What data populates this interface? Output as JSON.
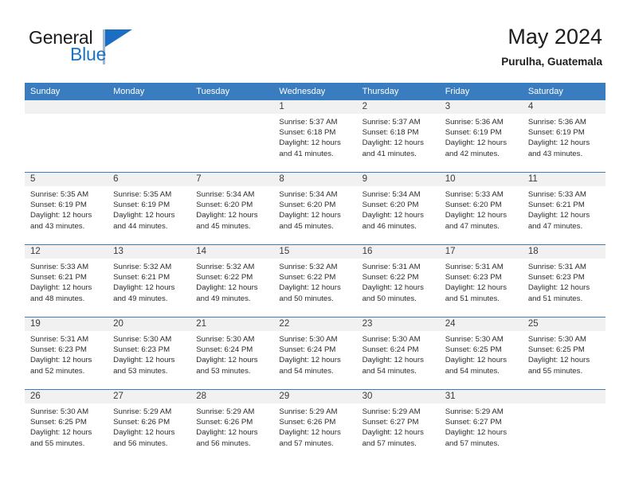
{
  "brand": {
    "name_part1": "General",
    "name_part2": "Blue",
    "logo_icon": "triangle-logo-icon"
  },
  "header": {
    "month_title": "May 2024",
    "location": "Purulha, Guatemala"
  },
  "colors": {
    "header_blue": "#3a7cc0",
    "brand_blue": "#1b74c4",
    "daynum_background": "#f1f1f1",
    "text": "#2c2c2c"
  },
  "calendar": {
    "weekdays": [
      "Sunday",
      "Monday",
      "Tuesday",
      "Wednesday",
      "Thursday",
      "Friday",
      "Saturday"
    ],
    "weeks": [
      [
        {
          "day": "",
          "empty": true
        },
        {
          "day": "",
          "empty": true
        },
        {
          "day": "",
          "empty": true
        },
        {
          "day": "1",
          "sunrise": "Sunrise: 5:37 AM",
          "sunset": "Sunset: 6:18 PM",
          "daylight": "Daylight: 12 hours and 41 minutes."
        },
        {
          "day": "2",
          "sunrise": "Sunrise: 5:37 AM",
          "sunset": "Sunset: 6:18 PM",
          "daylight": "Daylight: 12 hours and 41 minutes."
        },
        {
          "day": "3",
          "sunrise": "Sunrise: 5:36 AM",
          "sunset": "Sunset: 6:19 PM",
          "daylight": "Daylight: 12 hours and 42 minutes."
        },
        {
          "day": "4",
          "sunrise": "Sunrise: 5:36 AM",
          "sunset": "Sunset: 6:19 PM",
          "daylight": "Daylight: 12 hours and 43 minutes."
        }
      ],
      [
        {
          "day": "5",
          "sunrise": "Sunrise: 5:35 AM",
          "sunset": "Sunset: 6:19 PM",
          "daylight": "Daylight: 12 hours and 43 minutes."
        },
        {
          "day": "6",
          "sunrise": "Sunrise: 5:35 AM",
          "sunset": "Sunset: 6:19 PM",
          "daylight": "Daylight: 12 hours and 44 minutes."
        },
        {
          "day": "7",
          "sunrise": "Sunrise: 5:34 AM",
          "sunset": "Sunset: 6:20 PM",
          "daylight": "Daylight: 12 hours and 45 minutes."
        },
        {
          "day": "8",
          "sunrise": "Sunrise: 5:34 AM",
          "sunset": "Sunset: 6:20 PM",
          "daylight": "Daylight: 12 hours and 45 minutes."
        },
        {
          "day": "9",
          "sunrise": "Sunrise: 5:34 AM",
          "sunset": "Sunset: 6:20 PM",
          "daylight": "Daylight: 12 hours and 46 minutes."
        },
        {
          "day": "10",
          "sunrise": "Sunrise: 5:33 AM",
          "sunset": "Sunset: 6:20 PM",
          "daylight": "Daylight: 12 hours and 47 minutes."
        },
        {
          "day": "11",
          "sunrise": "Sunrise: 5:33 AM",
          "sunset": "Sunset: 6:21 PM",
          "daylight": "Daylight: 12 hours and 47 minutes."
        }
      ],
      [
        {
          "day": "12",
          "sunrise": "Sunrise: 5:33 AM",
          "sunset": "Sunset: 6:21 PM",
          "daylight": "Daylight: 12 hours and 48 minutes."
        },
        {
          "day": "13",
          "sunrise": "Sunrise: 5:32 AM",
          "sunset": "Sunset: 6:21 PM",
          "daylight": "Daylight: 12 hours and 49 minutes."
        },
        {
          "day": "14",
          "sunrise": "Sunrise: 5:32 AM",
          "sunset": "Sunset: 6:22 PM",
          "daylight": "Daylight: 12 hours and 49 minutes."
        },
        {
          "day": "15",
          "sunrise": "Sunrise: 5:32 AM",
          "sunset": "Sunset: 6:22 PM",
          "daylight": "Daylight: 12 hours and 50 minutes."
        },
        {
          "day": "16",
          "sunrise": "Sunrise: 5:31 AM",
          "sunset": "Sunset: 6:22 PM",
          "daylight": "Daylight: 12 hours and 50 minutes."
        },
        {
          "day": "17",
          "sunrise": "Sunrise: 5:31 AM",
          "sunset": "Sunset: 6:23 PM",
          "daylight": "Daylight: 12 hours and 51 minutes."
        },
        {
          "day": "18",
          "sunrise": "Sunrise: 5:31 AM",
          "sunset": "Sunset: 6:23 PM",
          "daylight": "Daylight: 12 hours and 51 minutes."
        }
      ],
      [
        {
          "day": "19",
          "sunrise": "Sunrise: 5:31 AM",
          "sunset": "Sunset: 6:23 PM",
          "daylight": "Daylight: 12 hours and 52 minutes."
        },
        {
          "day": "20",
          "sunrise": "Sunrise: 5:30 AM",
          "sunset": "Sunset: 6:23 PM",
          "daylight": "Daylight: 12 hours and 53 minutes."
        },
        {
          "day": "21",
          "sunrise": "Sunrise: 5:30 AM",
          "sunset": "Sunset: 6:24 PM",
          "daylight": "Daylight: 12 hours and 53 minutes."
        },
        {
          "day": "22",
          "sunrise": "Sunrise: 5:30 AM",
          "sunset": "Sunset: 6:24 PM",
          "daylight": "Daylight: 12 hours and 54 minutes."
        },
        {
          "day": "23",
          "sunrise": "Sunrise: 5:30 AM",
          "sunset": "Sunset: 6:24 PM",
          "daylight": "Daylight: 12 hours and 54 minutes."
        },
        {
          "day": "24",
          "sunrise": "Sunrise: 5:30 AM",
          "sunset": "Sunset: 6:25 PM",
          "daylight": "Daylight: 12 hours and 54 minutes."
        },
        {
          "day": "25",
          "sunrise": "Sunrise: 5:30 AM",
          "sunset": "Sunset: 6:25 PM",
          "daylight": "Daylight: 12 hours and 55 minutes."
        }
      ],
      [
        {
          "day": "26",
          "sunrise": "Sunrise: 5:30 AM",
          "sunset": "Sunset: 6:25 PM",
          "daylight": "Daylight: 12 hours and 55 minutes."
        },
        {
          "day": "27",
          "sunrise": "Sunrise: 5:29 AM",
          "sunset": "Sunset: 6:26 PM",
          "daylight": "Daylight: 12 hours and 56 minutes."
        },
        {
          "day": "28",
          "sunrise": "Sunrise: 5:29 AM",
          "sunset": "Sunset: 6:26 PM",
          "daylight": "Daylight: 12 hours and 56 minutes."
        },
        {
          "day": "29",
          "sunrise": "Sunrise: 5:29 AM",
          "sunset": "Sunset: 6:26 PM",
          "daylight": "Daylight: 12 hours and 57 minutes."
        },
        {
          "day": "30",
          "sunrise": "Sunrise: 5:29 AM",
          "sunset": "Sunset: 6:27 PM",
          "daylight": "Daylight: 12 hours and 57 minutes."
        },
        {
          "day": "31",
          "sunrise": "Sunrise: 5:29 AM",
          "sunset": "Sunset: 6:27 PM",
          "daylight": "Daylight: 12 hours and 57 minutes."
        },
        {
          "day": "",
          "empty": true
        }
      ]
    ]
  }
}
